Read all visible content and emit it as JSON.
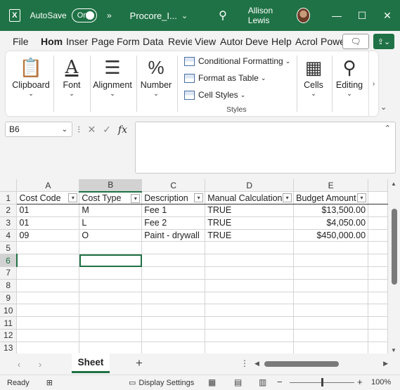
{
  "titlebar": {
    "autosave_label": "AutoSave",
    "toggle_label": "On",
    "document_title": "Procore_I...",
    "user_name": "Allison Lewis"
  },
  "menu": [
    "File",
    "Home",
    "Insert",
    "Page",
    "Formulas",
    "Data",
    "Review",
    "View",
    "Automate",
    "Developer",
    "Help",
    "Acrobat",
    "Power"
  ],
  "menu_visible": [
    "File",
    "Hom",
    "Inser",
    "Page",
    "Form",
    "Data",
    "Revie",
    "View",
    "Autor",
    "Devel",
    "Help",
    "Acrol",
    "Powe"
  ],
  "ribbon": {
    "clipboard": "Clipboard",
    "font": "Font",
    "alignment": "Alignment",
    "number": "Number",
    "conditional_formatting": "Conditional Formatting",
    "format_as_table": "Format as Table",
    "cell_styles": "Cell Styles",
    "styles_group": "Styles",
    "cells": "Cells",
    "editing": "Editing"
  },
  "formula_bar": {
    "name_box": "B6",
    "formula": ""
  },
  "columns": [
    "A",
    "B",
    "C",
    "D",
    "E"
  ],
  "selected_column": "B",
  "selected_row": "6",
  "table": {
    "headers": [
      "Cost Code",
      "Cost Type",
      "Description",
      "Manual Calculation",
      "Budget Amount"
    ],
    "rows": [
      [
        "01",
        "M",
        "Fee 1",
        "TRUE",
        "$13,500.00"
      ],
      [
        "01",
        "L",
        "Fee 2",
        "TRUE",
        "$4,050.00"
      ],
      [
        "09",
        "O",
        "Paint - drywall",
        "TRUE",
        "$450,000.00"
      ]
    ]
  },
  "row_numbers": [
    "1",
    "2",
    "3",
    "4",
    "5",
    "6",
    "7",
    "8",
    "9",
    "10",
    "11",
    "12",
    "13"
  ],
  "sheet_tab": "Sheet",
  "status": {
    "ready": "Ready",
    "display_settings": "Display Settings",
    "zoom": "100%"
  },
  "colors": {
    "brand": "#1f7245",
    "grid_line": "#d4d4d4"
  }
}
